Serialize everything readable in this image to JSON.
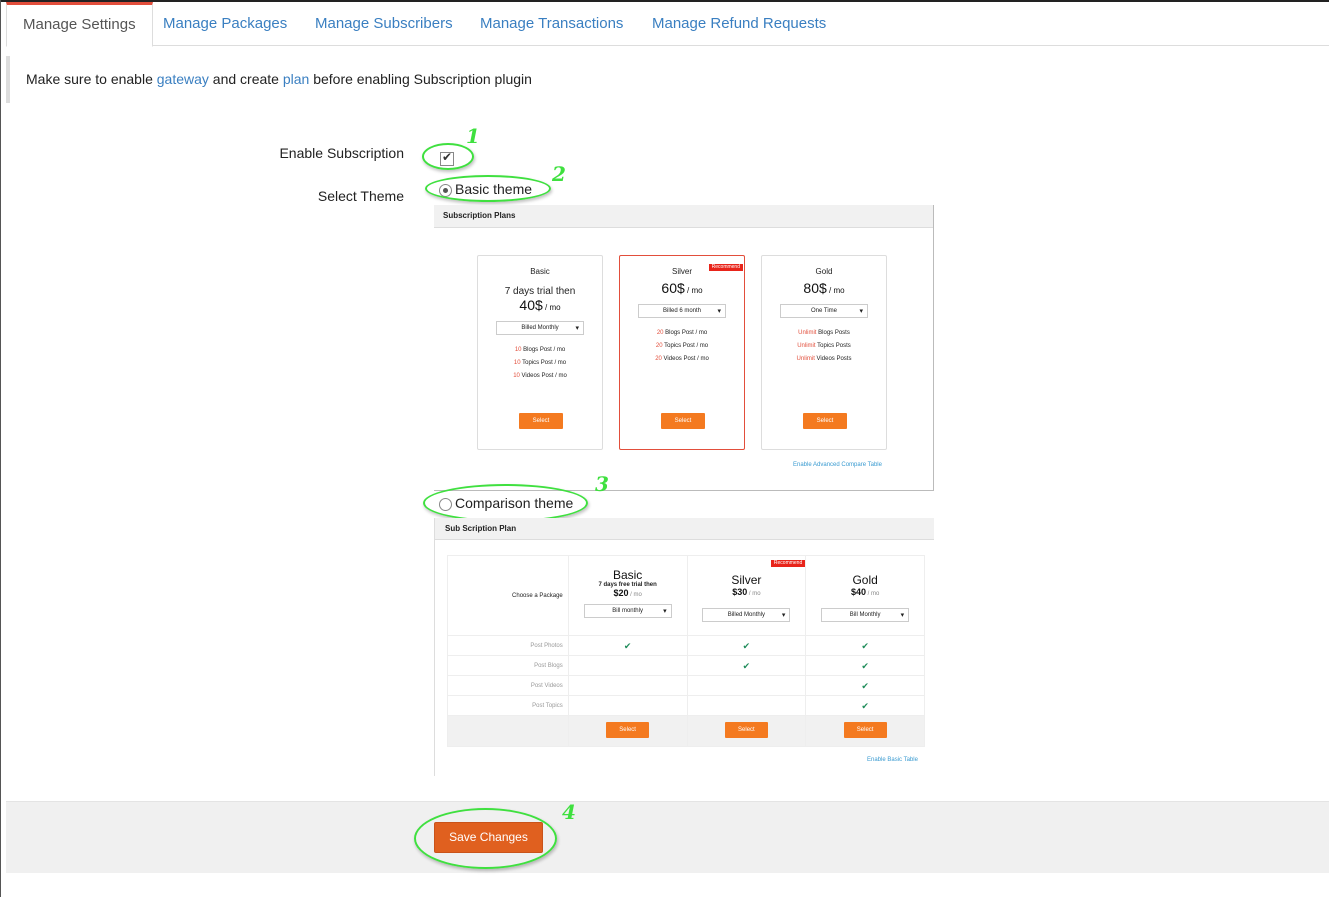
{
  "tabs": [
    {
      "label": "Manage Settings"
    },
    {
      "label": "Manage Packages"
    },
    {
      "label": "Manage Subscribers"
    },
    {
      "label": "Manage Transactions"
    },
    {
      "label": "Manage Refund Requests"
    }
  ],
  "notice": {
    "pre": "Make sure to enable ",
    "link1": "gateway",
    "mid": " and create ",
    "link2": "plan",
    "post": " before enabling Subscription plugin"
  },
  "form": {
    "enable_label": "Enable Subscription",
    "enable_checked": true,
    "theme_label": "Select Theme",
    "basic_theme": "Basic theme",
    "comparison_theme": "Comparison theme"
  },
  "annotations": [
    "1",
    "2",
    "3",
    "4"
  ],
  "basic_preview": {
    "header": "Subscription Plans",
    "cards": [
      {
        "name": "Basic",
        "trial": "7 days trial then",
        "price": "40$",
        "unit": " / mo",
        "billing": "Billed Monthly",
        "features": [
          {
            "hl": "10",
            "text": " Blogs Post / mo"
          },
          {
            "hl": "10",
            "text": " Topics Post / mo"
          },
          {
            "hl": "10",
            "text": " Videos Post / mo"
          }
        ],
        "select": "Select"
      },
      {
        "name": "Silver",
        "ribbon": "Recommend",
        "price": "60$",
        "unit": " / mo",
        "billing": "Billed 6 month",
        "features": [
          {
            "hl": "20",
            "text": " Blogs Post / mo"
          },
          {
            "hl": "20",
            "text": " Topics Post / mo"
          },
          {
            "hl": "20",
            "text": " Videos Post / mo"
          }
        ],
        "select": "Select"
      },
      {
        "name": "Gold",
        "price": "80$",
        "unit": " / mo",
        "billing": "One Time",
        "features": [
          {
            "hl": "Unlimit",
            "text": " Blogs Posts"
          },
          {
            "hl": "Unlimit",
            "text": " Topics Posts"
          },
          {
            "hl": "Unlimit",
            "text": " Videos Posts"
          }
        ],
        "select": "Select"
      }
    ],
    "link": "Enable Advanced  Compare Table"
  },
  "comparison_preview": {
    "header": "Sub Scription Plan",
    "choose_label": "Choose a Package",
    "packages": [
      {
        "name": "Basic",
        "trial": "7 days free trial then",
        "price": "$20",
        "unit": " / mo",
        "billing": "Bill monthly"
      },
      {
        "name": "Silver",
        "ribbon": "Recommend",
        "price": "$30",
        "unit": " / mo",
        "billing": "Billed Monthly"
      },
      {
        "name": "Gold",
        "price": "$40",
        "unit": " / mo",
        "billing": "Bill Monthly"
      }
    ],
    "features": [
      {
        "label": "Post Photos",
        "checks": [
          true,
          true,
          true
        ]
      },
      {
        "label": "Post Blogs",
        "checks": [
          false,
          true,
          true
        ]
      },
      {
        "label": "Post Videos",
        "checks": [
          false,
          false,
          true
        ]
      },
      {
        "label": "Post Topics",
        "checks": [
          false,
          false,
          true
        ]
      }
    ],
    "check_glyph": "✔",
    "select": "Select",
    "link": "Enable Basic Table"
  },
  "footer": {
    "save": "Save Changes"
  },
  "colors": {
    "accent": "#f47a20",
    "save": "#e0601f",
    "link": "#3a7fc1",
    "annotation": "#3fe03f",
    "ribbon": "#e8241a"
  }
}
